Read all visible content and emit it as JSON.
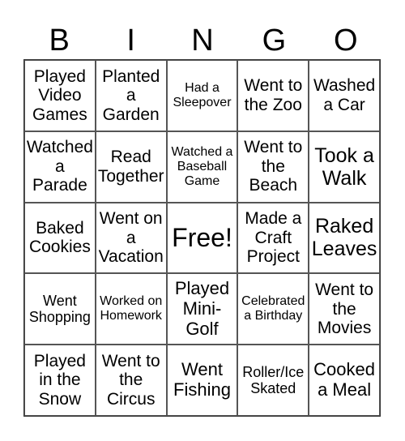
{
  "header": [
    "B",
    "I",
    "N",
    "G",
    "O"
  ],
  "cells": [
    [
      "Played Video Games",
      "Planted a Garden",
      "Had a Sleepover",
      "Went to the Zoo",
      "Washed a Car"
    ],
    [
      "Watched a Parade",
      "Read Together",
      "Watched a Baseball Game",
      "Went to the Beach",
      "Took a Walk"
    ],
    [
      "Baked Cookies",
      "Went on a Vacation",
      "Free!",
      "Made a Craft Project",
      "Raked Leaves"
    ],
    [
      "Went Shopping",
      "Worked on Homework",
      "Played Mini-Golf",
      "Celebrated a Birthday",
      "Went to the Movies"
    ],
    [
      "Played in the Snow",
      "Went to the Circus",
      "Went Fishing",
      "Roller/Ice Skated",
      "Cooked a Meal"
    ]
  ]
}
